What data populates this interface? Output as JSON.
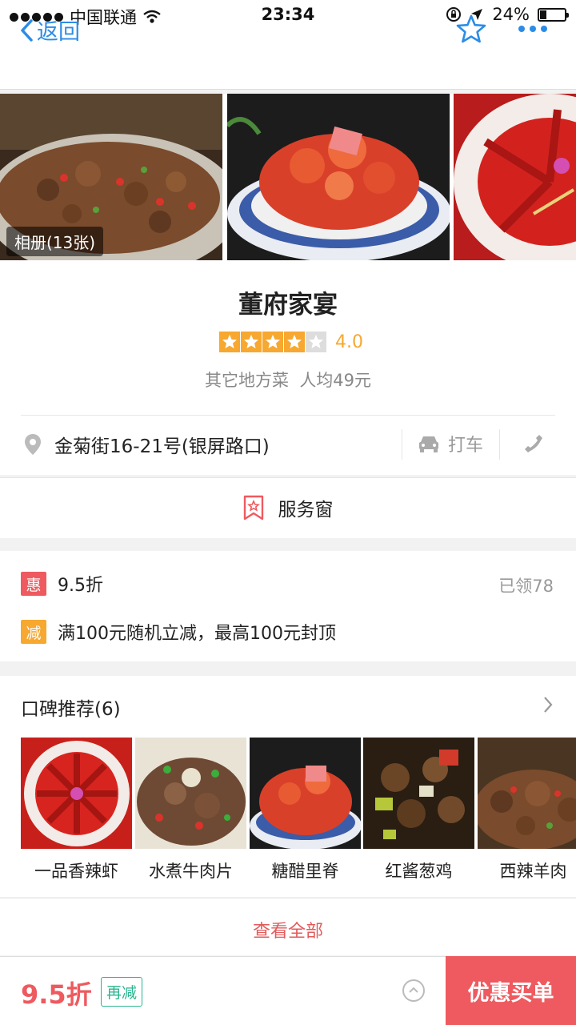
{
  "status_bar": {
    "carrier": "中国联通",
    "time": "23:34",
    "battery": "24%",
    "battery_level": 0.24
  },
  "nav": {
    "back_label": "返回"
  },
  "gallery": {
    "album_label": "相册(13张)"
  },
  "shop": {
    "name": "董府家宴",
    "rating": 4.0,
    "rating_text": "4.0",
    "cuisine": "其它地方菜",
    "avg_price": "人均49元",
    "address": "金菊街16-21号(银屏路口)",
    "taxi_label": "打车"
  },
  "service": {
    "label": "服务窗"
  },
  "promotions": {
    "items": [
      {
        "badge": "惠",
        "badge_color": "#ee5a5f",
        "text": "9.5折"
      },
      {
        "badge": "减",
        "badge_color": "#f7a830",
        "text": "满100元随机立减，最高100元封顶"
      }
    ],
    "claimed": "已领78"
  },
  "reviews": {
    "title": "口碑推荐(6)",
    "dishes": [
      {
        "name": "一品香辣虾"
      },
      {
        "name": "水煮牛肉片"
      },
      {
        "name": "糖醋里脊"
      },
      {
        "name": "红酱葱鸡"
      },
      {
        "name": "西辣羊肉"
      }
    ],
    "view_all": "查看全部"
  },
  "bottom": {
    "discount": "9.5折",
    "extra_badge": "再减",
    "pay_button": "优惠买单"
  },
  "colors": {
    "accent_blue": "#2b8ce6",
    "accent_red": "#ee5a5f",
    "star_orange": "#f7a830",
    "badge_green": "#2ab58f"
  }
}
